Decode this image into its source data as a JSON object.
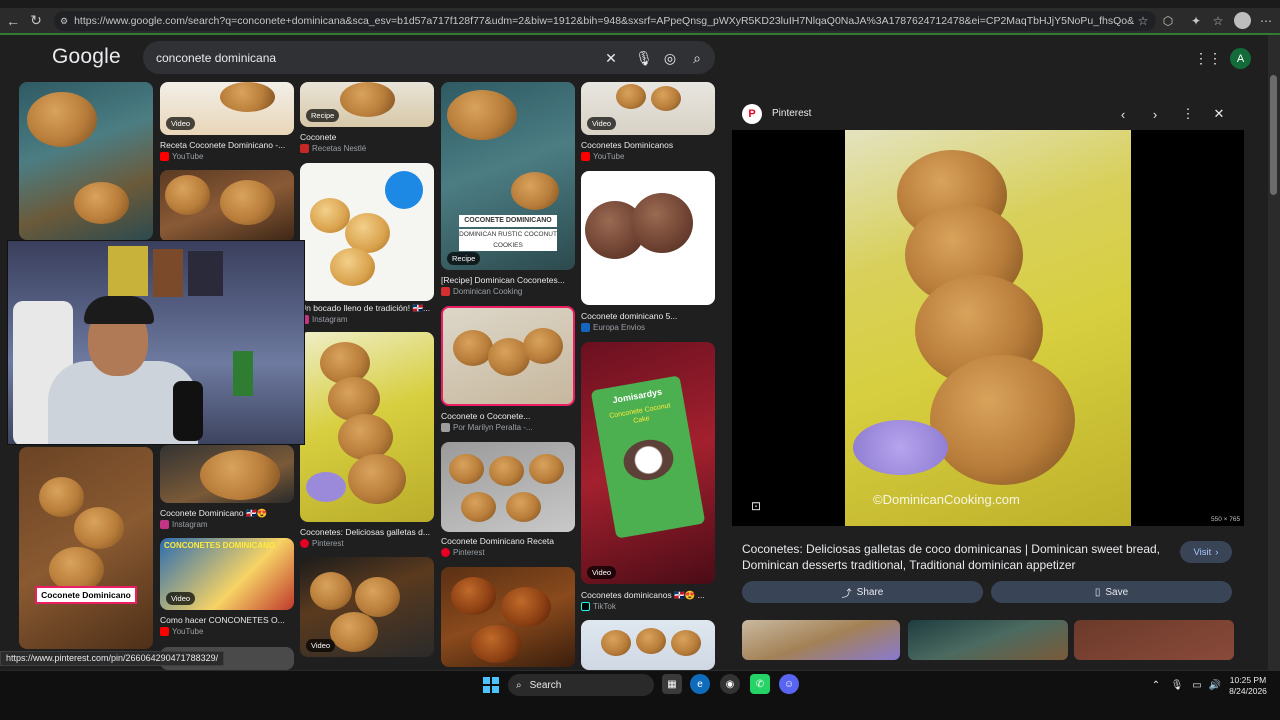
{
  "browser": {
    "url": "https://www.google.com/search?q=conconete+dominicana&sca_esv=b1d57a717f128f77&udm=2&biw=1912&bih=948&sxsrf=APpeQnsg_pWXyR5KD23luIH7NlqaQ0NaJA%3A1787624712478&ei=CP2MaqTbHJjY5NoPu_fhsQo&ved=0ahUKEwik_-n_3LqWA...",
    "status_url": "https://www.pinterest.com/pin/266064290471788329/"
  },
  "google": {
    "logo": "Google",
    "query": "conconete dominicana",
    "account_initial": "A"
  },
  "results": [
    {
      "caption": "",
      "source": ""
    },
    {
      "caption": "Receta Coconete Dominicano -...",
      "source": "YouTube",
      "badge": "Video"
    },
    {
      "caption": "Coconete",
      "source": "Recetas Nestlé",
      "badge": "Recipe"
    },
    {
      "caption": "",
      "source": ""
    },
    {
      "caption": "Coconetes Dominicanos",
      "source": "YouTube",
      "badge": "Video"
    },
    {
      "caption": "Un bocado lleno de tradición! 🇩🇴...",
      "source": "Instagram"
    },
    {
      "caption": "[Recipe] Dominican Coconetes...",
      "source": "Dominican Cooking",
      "badge": "Recipe"
    },
    {
      "caption": "Coconete dominicano 5...",
      "source": "Europa Envios"
    },
    {
      "caption": "Coconete o Coconete...",
      "source": "Por Marilyn Peralta -..."
    },
    {
      "caption": "Coconete Dominicano 🇩🇴😍",
      "source": "Instagram"
    },
    {
      "caption": "Coconetes: Deliciosas galletas d...",
      "source": "Pinterest"
    },
    {
      "caption": "Coconete Dominicano Receta",
      "source": "Pinterest"
    },
    {
      "caption": "Coconetes dominicanos 🇩🇴😍 ...",
      "source": "TikTok",
      "badge": "Video"
    },
    {
      "caption": "Como hacer CONCONETES O...",
      "source": "YouTube",
      "badge": "Video"
    },
    {
      "caption": "",
      "source": "",
      "badge": "Video"
    }
  ],
  "thumb_text": {
    "coconete_label": "Coconete Dominicano",
    "dominican_title": "COCONETE DOMINICANO",
    "dominican_sub": "DOMINICAN RUSTIC COCONUT COOKIES",
    "yt_banner": "CONCONETES DOMINICANO",
    "bag_brand": "Jomisardys",
    "bag_product": "Conconete Coconut Cake"
  },
  "panel": {
    "source": "Pinterest",
    "title": "Coconetes: Deliciosas galletas de coco dominicanas | Dominican sweet bread, Dominican desserts traditional, Traditional dominican appetizer",
    "watermark": "©DominicanCooking.com",
    "dimensions": "550 × 765",
    "visit_label": "Visit",
    "share_label": "Share",
    "save_label": "Save"
  },
  "taskbar": {
    "search_label": "Search",
    "time": "10:25 PM",
    "date": "8/24/2026"
  },
  "colors": {
    "accent_green": "#2e7d32",
    "youtube": "#ff0000",
    "pinterest": "#e60023",
    "instagram": "#c13584"
  }
}
